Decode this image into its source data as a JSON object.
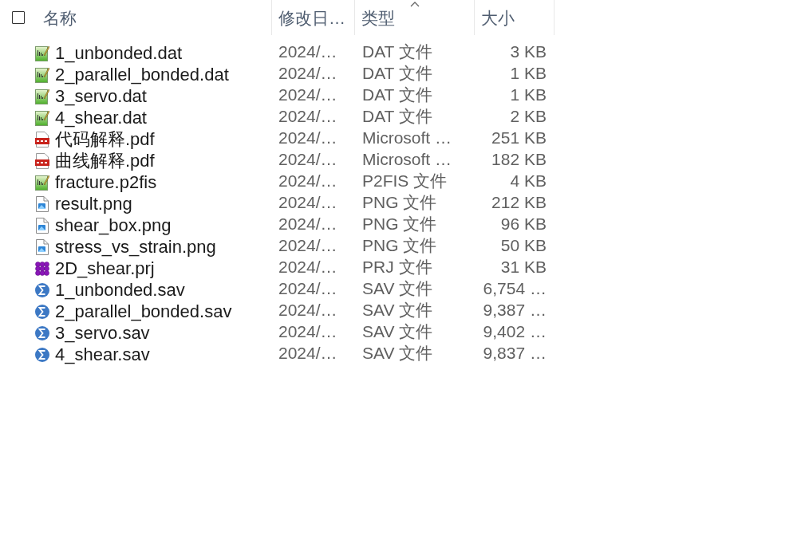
{
  "header": {
    "select_all": {
      "checked": false
    },
    "columns": [
      {
        "label": "名称",
        "sorted": false
      },
      {
        "label": "修改日…",
        "sorted": false
      },
      {
        "label": "类型",
        "sorted": true
      },
      {
        "label": "大小",
        "sorted": false
      }
    ]
  },
  "files": [
    {
      "kind": "dat",
      "name": "1_unbonded.dat",
      "modified": "2024/…",
      "type": "DAT 文件",
      "size": "3 KB"
    },
    {
      "kind": "dat",
      "name": "2_parallel_bonded.dat",
      "modified": "2024/…",
      "type": "DAT 文件",
      "size": "1 KB"
    },
    {
      "kind": "dat",
      "name": "3_servo.dat",
      "modified": "2024/…",
      "type": "DAT 文件",
      "size": "1 KB"
    },
    {
      "kind": "dat",
      "name": "4_shear.dat",
      "modified": "2024/…",
      "type": "DAT 文件",
      "size": "2 KB"
    },
    {
      "kind": "pdf",
      "name": "代码解释.pdf",
      "modified": "2024/…",
      "type": "Microsoft …",
      "size": "251 KB"
    },
    {
      "kind": "pdf",
      "name": "曲线解释.pdf",
      "modified": "2024/…",
      "type": "Microsoft …",
      "size": "182 KB"
    },
    {
      "kind": "dat",
      "name": "fracture.p2fis",
      "modified": "2024/…",
      "type": "P2FIS 文件",
      "size": "4 KB"
    },
    {
      "kind": "image",
      "name": "result.png",
      "modified": "2024/…",
      "type": "PNG 文件",
      "size": "212 KB"
    },
    {
      "kind": "image",
      "name": "shear_box.png",
      "modified": "2024/…",
      "type": "PNG 文件",
      "size": "96 KB"
    },
    {
      "kind": "image",
      "name": "stress_vs_strain.png",
      "modified": "2024/…",
      "type": "PNG 文件",
      "size": "50 KB"
    },
    {
      "kind": "project",
      "name": "2D_shear.prj",
      "modified": "2024/…",
      "type": "PRJ 文件",
      "size": "31 KB"
    },
    {
      "kind": "sav",
      "name": "1_unbonded.sav",
      "modified": "2024/…",
      "type": "SAV 文件",
      "size": "6,754 …"
    },
    {
      "kind": "sav",
      "name": "2_parallel_bonded.sav",
      "modified": "2024/…",
      "type": "SAV 文件",
      "size": "9,387 …"
    },
    {
      "kind": "sav",
      "name": "3_servo.sav",
      "modified": "2024/…",
      "type": "SAV 文件",
      "size": "9,402 …"
    },
    {
      "kind": "sav",
      "name": "4_shear.sav",
      "modified": "2024/…",
      "type": "SAV 文件",
      "size": "9,837 …"
    }
  ]
}
